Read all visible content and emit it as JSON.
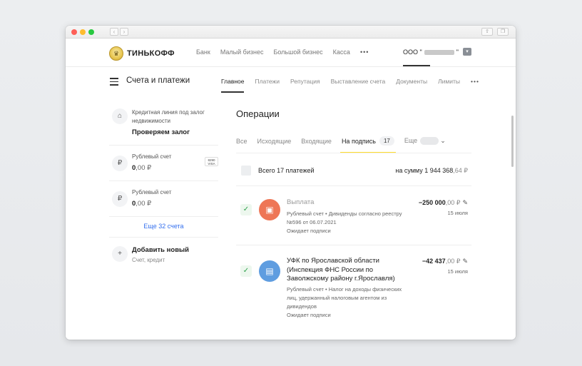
{
  "browser": {
    "back_label": "‹",
    "forward_label": "›",
    "share_label": "⇧",
    "tabs_label": "❐"
  },
  "topnav": {
    "logo_text": "ТИНЬКОФФ",
    "menu": [
      "Банк",
      "Малый бизнес",
      "Большой бизнес",
      "Касса"
    ],
    "more_label": "•••",
    "account_prefix": "ООО \"",
    "account_suffix": "\"",
    "account_icon": "chevron-down-icon"
  },
  "subnav": {
    "title": "Счета и платежи",
    "tabs": [
      "Главное",
      "Платежи",
      "Репутация",
      "Выставление счета",
      "Документы",
      "Лимиты"
    ],
    "active_tab": "Главное",
    "more_label": "•••"
  },
  "sidebar": {
    "credit": {
      "caption": "Кредитная линия под залог недвижимости",
      "status": "Проверяем залог",
      "icon": "house-clock-icon"
    },
    "accounts": [
      {
        "label": "Рублевый счет",
        "amount_main": "0",
        "amount_cents": ",00",
        "currency": "₽",
        "card": "8290\nVISA",
        "icon": "ruble-icon"
      },
      {
        "label": "Рублевый счет",
        "amount_main": "0",
        "amount_cents": ",00",
        "currency": "₽",
        "icon": "ruble-icon"
      }
    ],
    "more_accounts": "Еще 32 счета",
    "add_new": {
      "title": "Добавить новый",
      "subtitle": "Счет, кредит",
      "icon": "plus-icon"
    }
  },
  "operations": {
    "title": "Операции",
    "tabs": {
      "all": "Все",
      "outgoing": "Исходящие",
      "incoming": "Входящие",
      "to_sign": "На подпись",
      "to_sign_count": "17",
      "more": "Еще"
    },
    "summary": {
      "label": "Всего 17 платежей",
      "sum_prefix": "на сумму 1 944 368",
      "sum_cents": ",64 ₽"
    },
    "items": [
      {
        "title": "Выплата",
        "title_color": "#9a9a9a",
        "avatar_color": "#ee7656",
        "avatar_icon": "wallet-icon",
        "desc": "Рублевый счет  •  Дивиденды согласно реестру №596 от 06.07.2021",
        "status": "Ожидает подписи",
        "amount_main": "−250 000",
        "amount_cents": ",00 ₽",
        "date": "15 июля"
      },
      {
        "title": "УФК по Ярославской области (Инспекция ФНС России по Заволжскому району г.Ярославля)",
        "title_color": "#222222",
        "avatar_color": "#5f9de0",
        "avatar_icon": "document-icon",
        "desc": "Рублевый счет  •  Налог на доходы физических лиц, удержанный налоговым агентом из дивидендов",
        "status": "Ожидает подписи",
        "amount_main": "−42 437",
        "amount_cents": ",00 ₽",
        "date": "15 июля"
      }
    ]
  },
  "colors": {
    "accent_yellow": "#ffdd2d",
    "link_blue": "#336fee",
    "check_green": "#2ba04a"
  }
}
